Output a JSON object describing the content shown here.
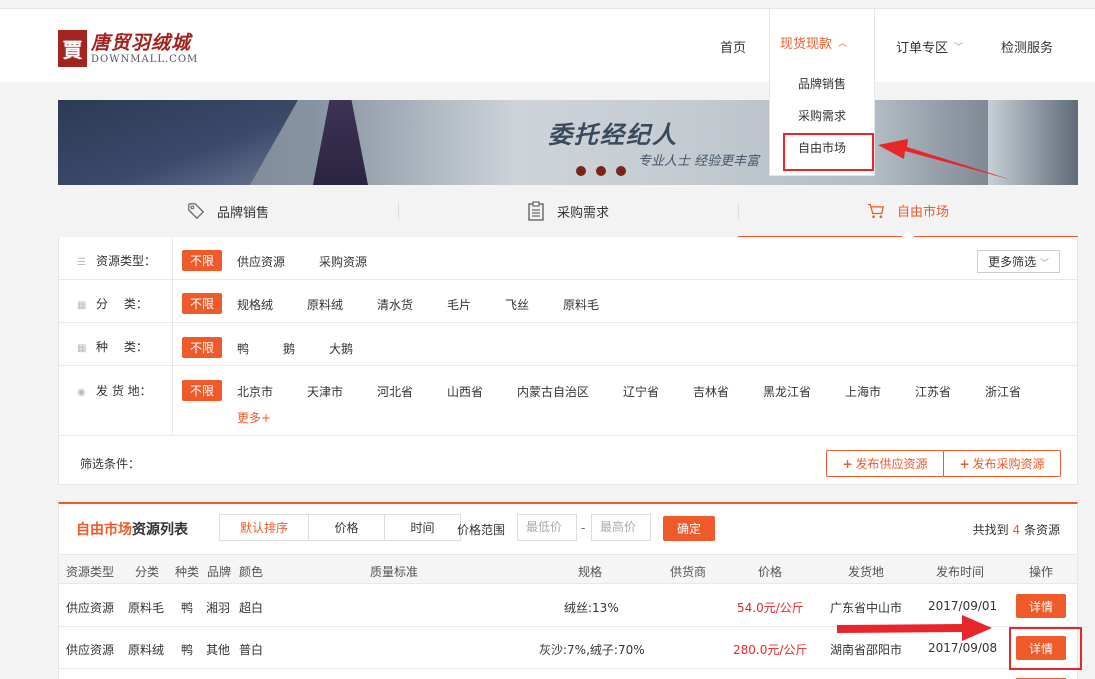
{
  "header": {
    "logo": {
      "seal": "賈",
      "main": "唐贸羽绒城",
      "sub": "DOWNMALL.COM"
    },
    "nav": [
      {
        "label": "首页"
      },
      {
        "label": "现货现款",
        "active": true
      },
      {
        "label": "订单专区"
      },
      {
        "label": "检测服务"
      }
    ],
    "dropdown": [
      "品牌销售",
      "采购需求",
      "自由市场"
    ]
  },
  "banner": {
    "title": "委托经纪人",
    "subtitle": "专业人士 经验更丰富"
  },
  "tabs": [
    {
      "label": "品牌销售",
      "icon": "tag-icon"
    },
    {
      "label": "采购需求",
      "icon": "clipboard-icon"
    },
    {
      "label": "自由市场",
      "icon": "cart-icon",
      "active": true
    }
  ],
  "filters": {
    "resource_type": {
      "label": "资源类型：",
      "options": [
        "不限",
        "供应资源",
        "采购资源"
      ]
    },
    "category": {
      "label": "分　 类：",
      "options": [
        "不限",
        "规格绒",
        "原料绒",
        "清水货",
        "毛片",
        "飞丝",
        "原料毛"
      ]
    },
    "species": {
      "label": "种　 类：",
      "options": [
        "不限",
        "鸭",
        "鹅",
        "大鹅"
      ]
    },
    "origin": {
      "label": "发 货 地：",
      "options": [
        "不限",
        "北京市",
        "天津市",
        "河北省",
        "山西省",
        "内蒙古自治区",
        "辽宁省",
        "吉林省",
        "黑龙江省",
        "上海市",
        "江苏省",
        "浙江省"
      ],
      "more": "更多+"
    },
    "more_filter": "更多筛选",
    "conditions_label": "筛选条件：",
    "publish_supply": "发布供应资源",
    "publish_purchase": "发布采购资源"
  },
  "list": {
    "title_highlight": "自由市场",
    "title_rest": "资源列表",
    "sort": [
      "默认排序",
      "价格",
      "时间"
    ],
    "price_range_label": "价格范围",
    "min_placeholder": "最低价",
    "max_placeholder": "最高价",
    "confirm": "确定",
    "found_prefix": "共找到",
    "found_count": "4",
    "found_suffix": "条资源",
    "columns": [
      "资源类型",
      "分类",
      "种类",
      "品牌",
      "颜色",
      "质量标准",
      "规格",
      "供货商",
      "价格",
      "发货地",
      "发布时间",
      "操作"
    ],
    "rows": [
      {
        "type": "供应资源",
        "category": "原料毛",
        "species": "鸭",
        "brand": "湘羽",
        "color": "超白",
        "quality": "",
        "spec": "绒丝:13%",
        "supplier": "",
        "price": "54.0元/公斤",
        "origin": "广东省中山市",
        "date": "2017/09/01",
        "action": "详情"
      },
      {
        "type": "供应资源",
        "category": "原料绒",
        "species": "鸭",
        "brand": "其他",
        "color": "普白",
        "quality": "",
        "spec": "灰沙:7%,绒子:70%",
        "supplier": "",
        "price": "280.0元/公斤",
        "origin": "湖南省邵阳市",
        "date": "2017/09/08",
        "action": "详情"
      }
    ]
  },
  "colors": {
    "accent": "#ee5a2a",
    "annotation_red": "#e8262a",
    "brand_red": "#a3231f"
  }
}
